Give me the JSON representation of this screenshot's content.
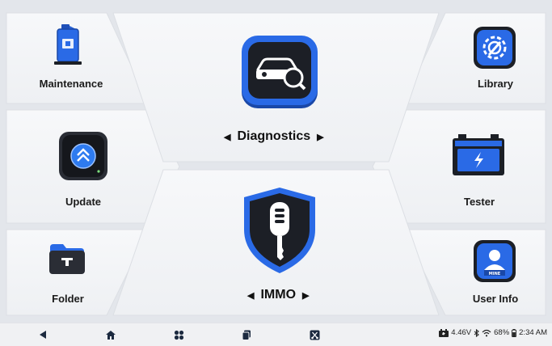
{
  "tiles": {
    "maintenance": "Maintenance",
    "update": "Update",
    "folder": "Folder",
    "library": "Library",
    "tester": "Tester",
    "user_info": "User Info",
    "diagnostics": "Diagnostics",
    "immo": "IMMO"
  },
  "arrows": {
    "left": "◀",
    "right": "▶"
  },
  "status": {
    "voltage": "4.46V",
    "battery": "68%",
    "time": "2:34 AM"
  },
  "icons": {
    "maintenance": "fuel-can-icon",
    "update": "update-arrow-icon",
    "folder": "folder-icon",
    "library": "gear-wrench-icon",
    "tester": "battery-icon",
    "user_info": "user-mine-icon",
    "diagnostics": "car-search-icon",
    "immo": "car-key-shield-icon"
  },
  "colors": {
    "accent": "#1e6ef0",
    "dark": "#1c1f26"
  }
}
